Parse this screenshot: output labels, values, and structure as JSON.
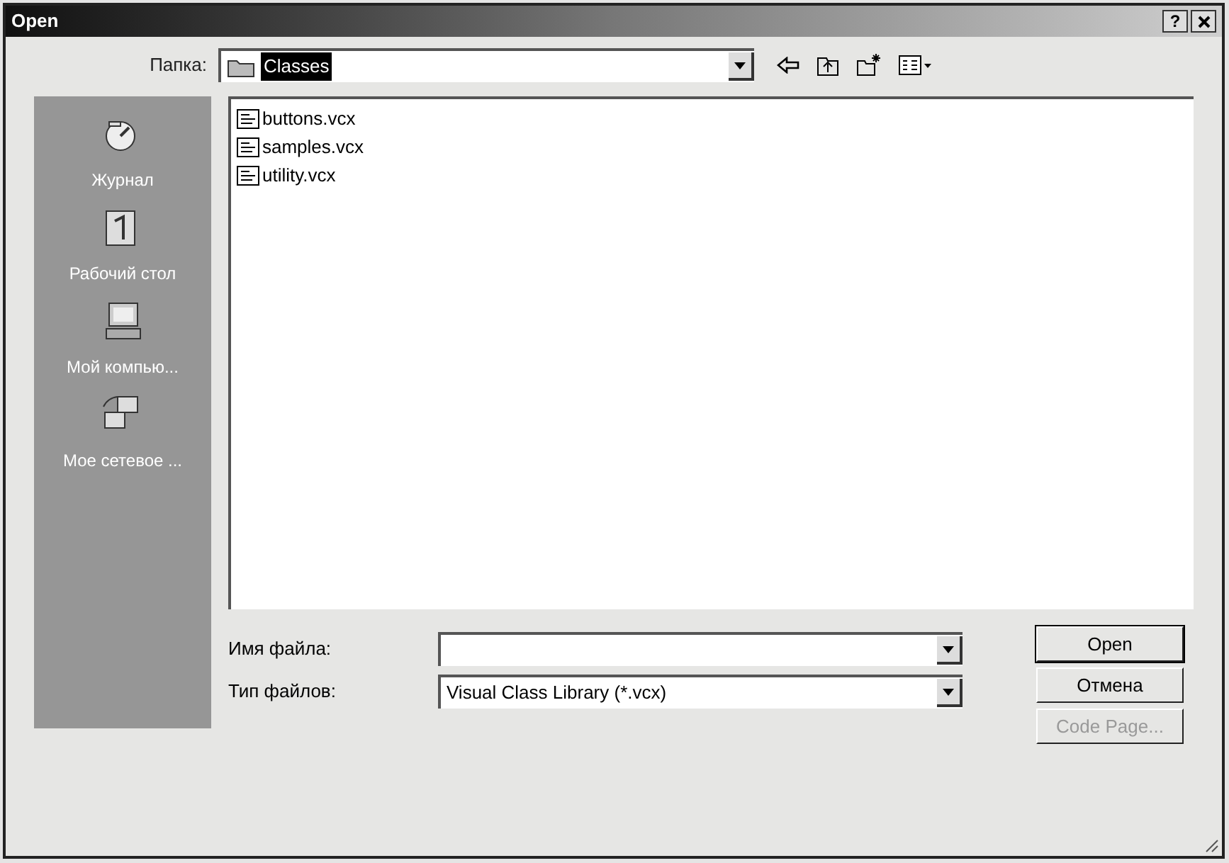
{
  "window": {
    "title": "Open",
    "help_button": "?"
  },
  "folder": {
    "label": "Папка:",
    "value": "Classes",
    "selected": true
  },
  "places": [
    {
      "label": "Журнал",
      "kind": "history"
    },
    {
      "label": "Рабочий стол",
      "kind": "desktop"
    },
    {
      "label": "Мой компью...",
      "kind": "computer"
    },
    {
      "label": "Мое сетевое ...",
      "kind": "network"
    }
  ],
  "files": [
    {
      "name": "buttons.vcx"
    },
    {
      "name": "samples.vcx"
    },
    {
      "name": "utility.vcx"
    }
  ],
  "file_name": {
    "label": "Имя файла:"
  },
  "file_type": {
    "label": "Тип файлов:",
    "value": "Visual Class Library (*.vcx)"
  },
  "buttons": [
    {
      "label": "Open",
      "disabled": false,
      "default": true
    },
    {
      "label": "Отмена",
      "disabled": false,
      "default": false
    },
    {
      "label": "Code Page...",
      "disabled": true,
      "default": false
    }
  ]
}
